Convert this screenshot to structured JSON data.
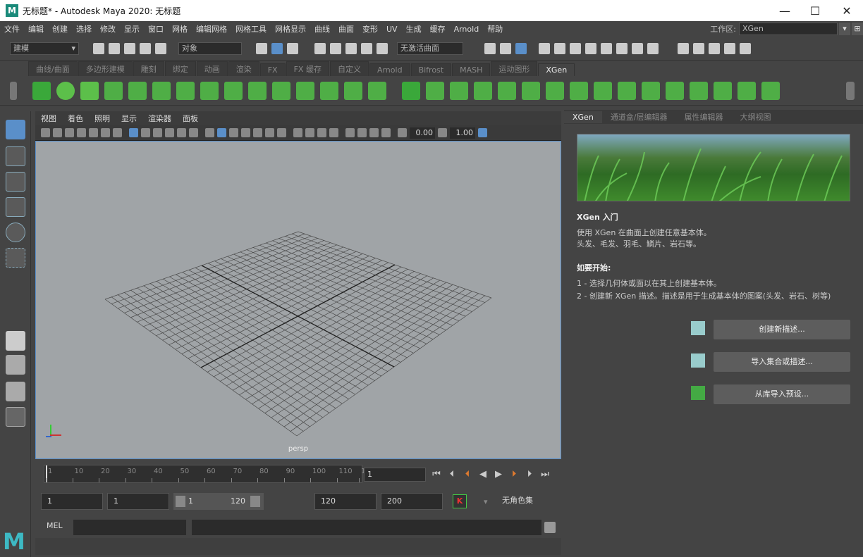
{
  "window": {
    "title": "无标题* - Autodesk Maya 2020: 无标题",
    "app_logo": "M",
    "minimize": "—",
    "maximize": "☐",
    "close": "✕"
  },
  "menu": [
    "文件",
    "编辑",
    "创建",
    "选择",
    "修改",
    "显示",
    "窗口",
    "网格",
    "编辑网格",
    "网格工具",
    "网格显示",
    "曲线",
    "曲面",
    "变形",
    "UV",
    "生成",
    "缓存",
    "Arnold",
    "帮助"
  ],
  "workspace": {
    "label": "工作区:",
    "value": "XGen"
  },
  "statusline": {
    "mode": "建模",
    "object_label": "对象",
    "live_surface": "无激活曲面"
  },
  "shelf_tabs": [
    "曲线/曲面",
    "多边形建模",
    "雕刻",
    "绑定",
    "动画",
    "渲染",
    "FX",
    "FX 缓存",
    "自定义",
    "Arnold",
    "Bifrost",
    "MASH",
    "运动图形",
    "XGen"
  ],
  "shelf_active": "XGen",
  "viewport": {
    "menu": [
      "视图",
      "着色",
      "照明",
      "显示",
      "渲染器",
      "面板"
    ],
    "exposure": "0.00",
    "gamma": "1.00",
    "camera": "persp"
  },
  "right_panel": {
    "tabs": [
      "XGen",
      "通道盒/层编辑器",
      "属性编辑器",
      "大纲视图"
    ],
    "active_tab": "XGen",
    "heading": "XGen 入门",
    "intro_line1": "使用 XGen 在曲面上创建任意基本体。",
    "intro_line2": "头发、毛发、羽毛、鳞片、岩石等。",
    "start_heading": "如要开始:",
    "step1": "1 - 选择几何体或面以在其上创建基本体。",
    "step2": "2 - 创建新 XGen 描述。描述是用于生成基本体的图案(头发、岩石、树等)",
    "buttons": [
      "创建新描述...",
      "导入集合或描述...",
      "从库导入预设..."
    ]
  },
  "timeslider": {
    "ticks": [
      "1",
      "10",
      "20",
      "30",
      "40",
      "50",
      "60",
      "70",
      "80",
      "90",
      "100",
      "110",
      "1"
    ],
    "current_frame": "1"
  },
  "range": {
    "start": "1",
    "playback_start": "1",
    "slider_start": "1",
    "slider_end": "120",
    "playback_end": "120",
    "end": "200",
    "character_set": "无角色集"
  },
  "command": {
    "lang": "MEL"
  },
  "logo": "M"
}
